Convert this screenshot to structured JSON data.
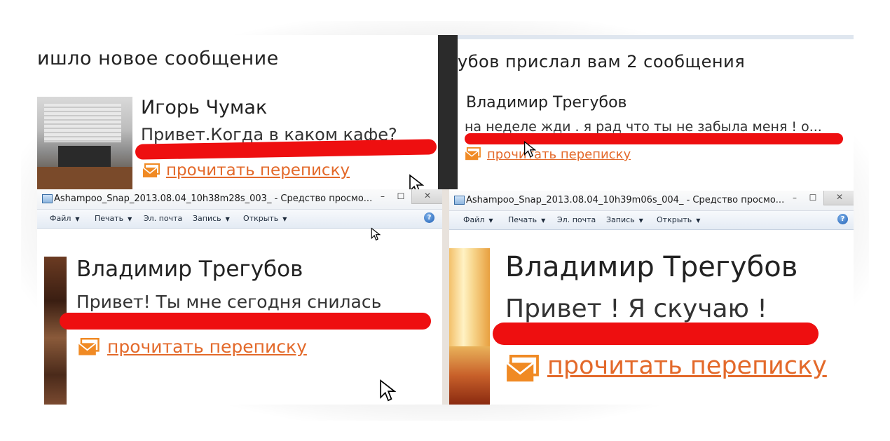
{
  "top_left": {
    "header": "ишло новое сообщение",
    "sender": "Игорь Чумак",
    "message": "Привет.Когда в каком кафе?",
    "link": "прочитать переписку"
  },
  "top_right": {
    "header": "убов прислал вам 2 сообщения",
    "sender": "Владимир Трегубов",
    "message": "на неделе жди . я рад что ты не забыла меня ! о...",
    "link": "прочитать переписку"
  },
  "bottom_left": {
    "window_title": "Ashampoo_Snap_2013.08.04_10h38m28s_003_ - Средство просмо...",
    "menu": [
      "Файл",
      "Печать",
      "Эл. почта",
      "Запись",
      "Открыть"
    ],
    "sender": "Владимир Трегубов",
    "message": "Привет! Ты мне сегодня снилась",
    "link": "прочитать переписку"
  },
  "bottom_right": {
    "window_title": "Ashampoo_Snap_2013.08.04_10h39m06s_004_ - Средство просмо...",
    "menu": [
      "Файл",
      "Печать",
      "Эл. почта",
      "Запись",
      "Открыть"
    ],
    "sender": "Владимир Трегубов",
    "message": "Привет ! Я скучаю !",
    "link": "прочитать переписку"
  },
  "window_controls": {
    "minimize": "–",
    "maximize": "☐",
    "close": "✕",
    "help": "?"
  },
  "colors": {
    "link": "#e3692a",
    "highlight": "#ee0f10",
    "mail_icon": "#f08a24"
  }
}
